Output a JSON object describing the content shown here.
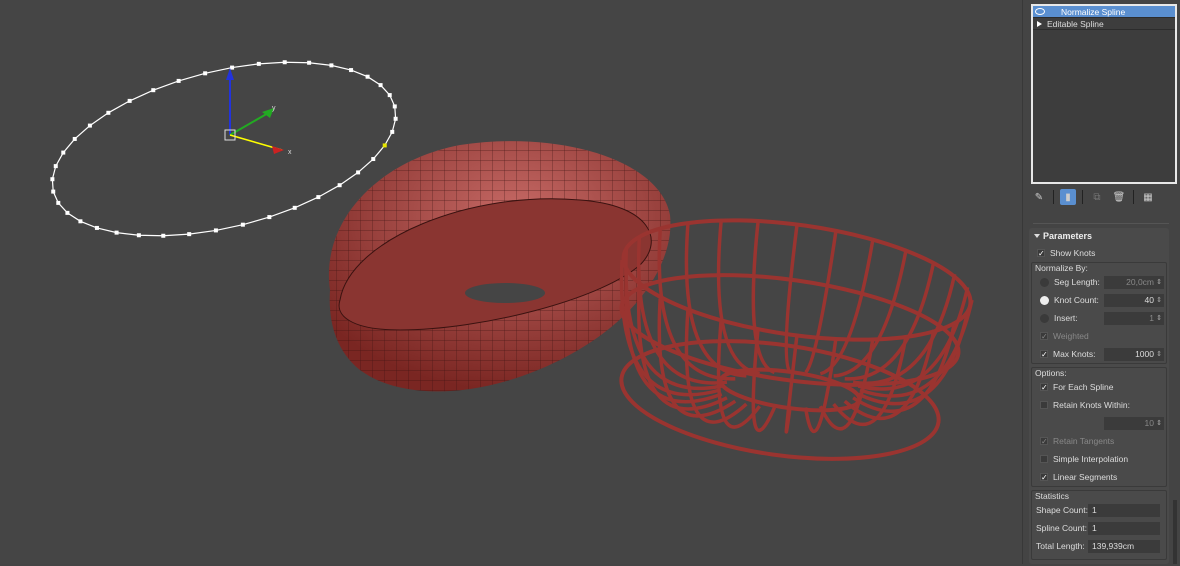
{
  "viewport": {
    "knot_count": 40,
    "gizmo_labels": {
      "x": "x",
      "y": "y"
    },
    "colors": {
      "object": "#a33a35",
      "spline": "#ffffff",
      "selected_knot": "#e8e800"
    }
  },
  "modifier_stack": [
    {
      "label": "Normalize Spline",
      "selected": true
    },
    {
      "label": "Editable Spline",
      "selected": false
    }
  ],
  "toolbar": [
    "pin-stack-icon",
    "show-end-result-icon",
    "make-unique-icon",
    "remove-modifier-icon",
    "configure-sets-icon"
  ],
  "parameters": {
    "title": "Parameters",
    "show_knots": "Show Knots",
    "normalize_by": "Normalize By:",
    "seg_length": {
      "label": "Seg Length:",
      "value": "20,0cm"
    },
    "knot_count": {
      "label": "Knot Count:",
      "value": "40"
    },
    "insert": {
      "label": "Insert:",
      "value": "1"
    },
    "weighted": "Weighted",
    "max_knots": {
      "label": "Max Knots:",
      "value": "1000"
    },
    "options": "Options:",
    "for_each_spline": "For Each Spline",
    "retain_knots_within": {
      "label": "Retain Knots Within:",
      "value": "10"
    },
    "retain_tangents": "Retain Tangents",
    "simple_interpolation": "Simple Interpolation",
    "linear_segments": "Linear Segments",
    "statistics": "Statistics",
    "shape_count": {
      "label": "Shape Count:",
      "value": "1"
    },
    "spline_count": {
      "label": "Spline Count:",
      "value": "1"
    },
    "total_length": {
      "label": "Total Length:",
      "value": "139,939cm"
    }
  }
}
